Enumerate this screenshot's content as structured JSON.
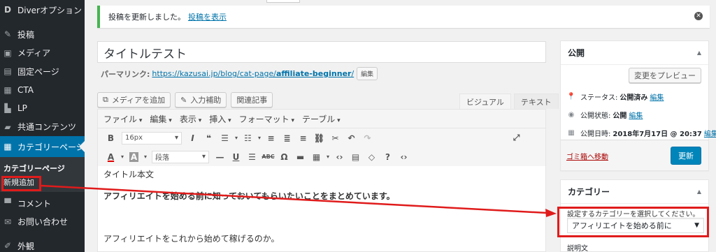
{
  "sidebar": {
    "items": [
      {
        "label": "Diverオプション",
        "icon": "diver-logo-icon"
      },
      {
        "label": "投稿",
        "icon": "pin-icon"
      },
      {
        "label": "メディア",
        "icon": "media-icon"
      },
      {
        "label": "固定ページ",
        "icon": "page-icon"
      },
      {
        "label": "CTA",
        "icon": "cta-icon"
      },
      {
        "label": "LP",
        "icon": "lp-icon"
      },
      {
        "label": "共通コンテンツ",
        "icon": "folder-icon"
      },
      {
        "label": "カテゴリーページ",
        "icon": "grid-icon"
      }
    ],
    "submenu": {
      "head": "カテゴリーページ",
      "item": "新規追加"
    },
    "bottom_items": [
      {
        "label": "コメント",
        "icon": "comment-icon"
      },
      {
        "label": "お問い合わせ",
        "icon": "mail-icon"
      },
      {
        "label": "外観",
        "icon": "brush-icon"
      }
    ]
  },
  "notice": {
    "text": "投稿を更新しました。",
    "link": "投稿を表示"
  },
  "post": {
    "title": "タイトルテスト",
    "permalink_label": "パーマリンク:",
    "permalink_base": "https://kazusai.jp/blog/cat-page/",
    "permalink_slug": "affiliate-beginner",
    "permalink_trailing": "/",
    "edit_label": "編集"
  },
  "media_buttons": [
    "メディアを追加",
    "入力補助",
    "関連記事"
  ],
  "editor_tabs": [
    "ビジュアル",
    "テキスト"
  ],
  "menubar": [
    "ファイル",
    "編集",
    "表示",
    "挿入",
    "フォーマット",
    "テーブル"
  ],
  "toolbar": {
    "font_size": "16px",
    "format": "段落"
  },
  "content": {
    "line1": "タイトル本文",
    "line2": "アフィリエイトを始める前に知っておいてもらいたいことをまとめています。",
    "line3": "アフィリエイトをこれから始めて稼げるのか。"
  },
  "publish": {
    "title": "公開",
    "preview_button": "変更をプレビュー",
    "status_label": "ステータス:",
    "status_value": "公開済み",
    "visibility_label": "公開状態:",
    "visibility_value": "公開",
    "date_label": "公開日時:",
    "date_value": "2018年7月17日 @ 20:37",
    "edit": "編集",
    "trash": "ゴミ箱へ移動",
    "update_button": "更新"
  },
  "category": {
    "title": "カテゴリー",
    "select_label": "設定するカテゴリーを選択してください。",
    "selected": "アフィリエイトを始める前に",
    "description_label": "説明文"
  },
  "colors": {
    "sidebar_bg": "#23282d",
    "active_blue": "#0073aa",
    "annotation_red": "#e01b1b",
    "primary_button": "#0085ba"
  }
}
